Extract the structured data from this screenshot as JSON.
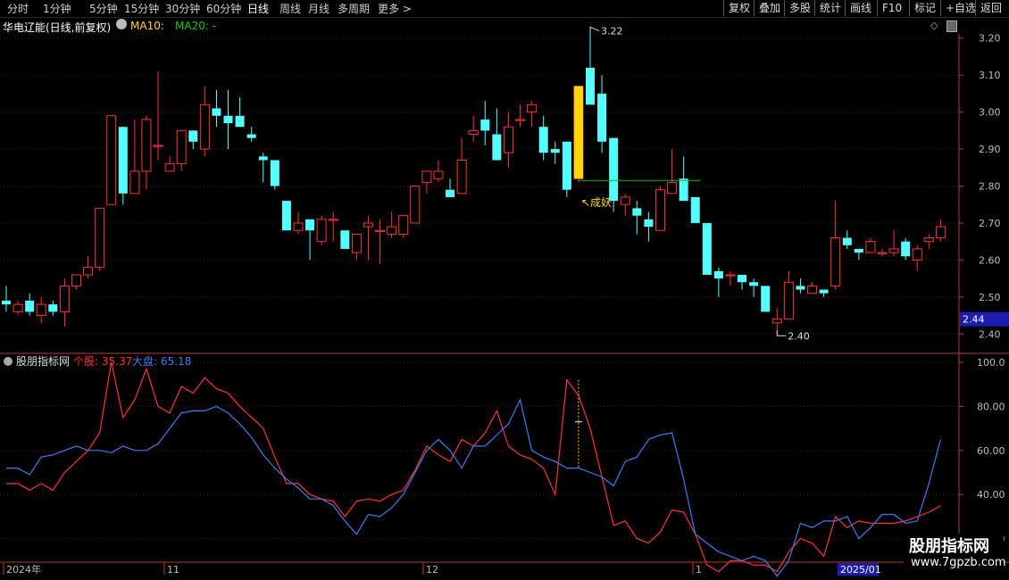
{
  "toolbar": {
    "left": [
      "分时",
      "1分钟",
      "5分钟",
      "15分钟",
      "30分钟",
      "60分钟",
      "日线",
      "周线",
      "月线",
      "多周期",
      "更多 >"
    ],
    "right": [
      "复权",
      "叠加",
      "多股",
      "统计",
      "画线",
      "F10",
      "标记",
      "+自选",
      "返回"
    ],
    "active": "日线"
  },
  "title": {
    "stock": "华电辽能(日线,前复权)",
    "ma10": "MA10: ",
    "ma20": "MA20: -"
  },
  "price_axis": {
    "labels": [
      "3.20",
      "3.10",
      "3.00",
      "2.90",
      "2.80",
      "2.70",
      "2.60",
      "2.50",
      "2.40"
    ],
    "current": "2.44"
  },
  "annotations": {
    "high": "3.22",
    "low": "2.40",
    "signal": "↖成妖"
  },
  "indicator": {
    "name": "股朋指标网",
    "s1_label": "个股: ",
    "s1_value": "35.37",
    "s2_label": "大盘: ",
    "s2_value": "65.18",
    "axis": [
      "100.0",
      "80.00",
      "60.00",
      "40.00",
      "20.00"
    ]
  },
  "date_axis": {
    "labels": [
      "2024年",
      "11",
      "12",
      "1",
      "2025/01"
    ]
  },
  "brand": {
    "line1": "股朋指标网",
    "line2": "www.7gpzb.com"
  },
  "colors": {
    "up": "#ff3232",
    "down": "#54ffff",
    "axis": "#c0392b",
    "signal": "#ffd700",
    "ma": "#00c000",
    "blue": "#3a7ef0"
  },
  "chart_data": {
    "type": "candlestick",
    "ylim": [
      2.35,
      3.25
    ],
    "candles": [
      [
        2.49,
        2.48,
        2.53,
        2.46
      ],
      [
        2.46,
        2.48,
        2.49,
        2.45
      ],
      [
        2.49,
        2.46,
        2.51,
        2.45
      ],
      [
        2.45,
        2.48,
        2.5,
        2.43
      ],
      [
        2.48,
        2.46,
        2.49,
        2.45
      ],
      [
        2.46,
        2.53,
        2.55,
        2.42
      ],
      [
        2.53,
        2.56,
        2.56,
        2.52
      ],
      [
        2.56,
        2.58,
        2.61,
        2.55
      ],
      [
        2.58,
        2.74,
        2.74,
        2.57
      ],
      [
        2.75,
        2.99,
        2.99,
        2.75
      ],
      [
        2.96,
        2.78,
        2.96,
        2.75
      ],
      [
        2.78,
        2.84,
        2.98,
        2.78
      ],
      [
        2.84,
        2.98,
        2.99,
        2.79
      ],
      [
        2.91,
        2.91,
        3.11,
        2.87
      ],
      [
        2.84,
        2.86,
        2.88,
        2.84
      ],
      [
        2.86,
        2.95,
        2.95,
        2.84
      ],
      [
        2.95,
        2.92,
        2.95,
        2.9
      ],
      [
        2.9,
        3.02,
        3.07,
        2.88
      ],
      [
        3.01,
        2.99,
        3.06,
        2.96
      ],
      [
        2.99,
        2.97,
        3.06,
        2.9
      ],
      [
        2.99,
        2.96,
        3.04,
        2.96
      ],
      [
        2.94,
        2.93,
        2.96,
        2.92
      ],
      [
        2.88,
        2.87,
        2.89,
        2.81
      ],
      [
        2.87,
        2.8,
        2.87,
        2.79
      ],
      [
        2.76,
        2.68,
        2.76,
        2.68
      ],
      [
        2.68,
        2.7,
        2.73,
        2.67
      ],
      [
        2.71,
        2.68,
        2.71,
        2.6
      ],
      [
        2.65,
        2.71,
        2.72,
        2.64
      ],
      [
        2.71,
        2.71,
        2.73,
        2.65
      ],
      [
        2.68,
        2.63,
        2.68,
        2.63
      ],
      [
        2.62,
        2.67,
        2.67,
        2.6
      ],
      [
        2.69,
        2.7,
        2.72,
        2.6
      ],
      [
        2.68,
        2.68,
        2.71,
        2.59
      ],
      [
        2.67,
        2.69,
        2.73,
        2.66
      ],
      [
        2.67,
        2.72,
        2.72,
        2.66
      ],
      [
        2.7,
        2.8,
        2.8,
        2.7
      ],
      [
        2.81,
        2.84,
        2.84,
        2.78
      ],
      [
        2.82,
        2.84,
        2.87,
        2.81
      ],
      [
        2.79,
        2.77,
        2.82,
        2.77
      ],
      [
        2.78,
        2.87,
        2.93,
        2.78
      ],
      [
        2.94,
        2.95,
        2.99,
        2.92
      ],
      [
        2.98,
        2.95,
        3.03,
        2.91
      ],
      [
        2.94,
        2.87,
        3.01,
        2.87
      ],
      [
        2.89,
        2.96,
        3.0,
        2.85
      ],
      [
        2.98,
        2.98,
        3.02,
        2.96
      ],
      [
        3.0,
        3.02,
        3.03,
        2.96
      ],
      [
        2.96,
        2.89,
        2.99,
        2.87
      ],
      [
        2.9,
        2.89,
        2.92,
        2.86
      ],
      [
        2.92,
        2.79,
        2.92,
        2.77
      ],
      [
        2.82,
        3.07,
        3.07,
        2.81
      ],
      [
        3.12,
        3.02,
        3.22,
        3.02
      ],
      [
        3.05,
        2.92,
        3.1,
        2.89
      ],
      [
        2.93,
        2.76,
        2.93,
        2.73
      ],
      [
        2.75,
        2.77,
        2.78,
        2.72
      ],
      [
        2.74,
        2.72,
        2.76,
        2.67
      ],
      [
        2.71,
        2.69,
        2.73,
        2.65
      ],
      [
        2.68,
        2.79,
        2.8,
        2.68
      ],
      [
        2.78,
        2.81,
        2.9,
        2.78
      ],
      [
        2.82,
        2.76,
        2.88,
        2.76
      ],
      [
        2.77,
        2.7,
        2.77,
        2.7
      ],
      [
        2.7,
        2.56,
        2.7,
        2.56
      ],
      [
        2.57,
        2.55,
        2.58,
        2.5
      ],
      [
        2.56,
        2.56,
        2.57,
        2.53
      ],
      [
        2.56,
        2.54,
        2.55,
        2.52
      ],
      [
        2.54,
        2.53,
        2.55,
        2.5
      ],
      [
        2.53,
        2.46,
        2.53,
        2.46
      ],
      [
        2.43,
        2.44,
        2.47,
        2.4
      ],
      [
        2.44,
        2.54,
        2.57,
        2.44
      ],
      [
        2.53,
        2.52,
        2.55,
        2.51
      ],
      [
        2.51,
        2.53,
        2.54,
        2.51
      ],
      [
        2.52,
        2.51,
        2.52,
        2.5
      ],
      [
        2.53,
        2.66,
        2.76,
        2.52
      ],
      [
        2.66,
        2.64,
        2.68,
        2.63
      ],
      [
        2.63,
        2.62,
        2.63,
        2.6
      ],
      [
        2.62,
        2.65,
        2.66,
        2.62
      ],
      [
        2.62,
        2.62,
        2.63,
        2.61
      ],
      [
        2.62,
        2.63,
        2.68,
        2.61
      ],
      [
        2.65,
        2.61,
        2.66,
        2.6
      ],
      [
        2.6,
        2.63,
        2.64,
        2.57
      ],
      [
        2.65,
        2.66,
        2.67,
        2.63
      ],
      [
        2.66,
        2.69,
        2.71,
        2.65
      ]
    ],
    "indicator_series": [
      {
        "name": "个股",
        "color": "#ff3232",
        "values": [
          45,
          45,
          42,
          45,
          42,
          50,
          55,
          60,
          68,
          100,
          75,
          83,
          97,
          80,
          77,
          89,
          86,
          93,
          88,
          86,
          80,
          75,
          70,
          57,
          45,
          45,
          40,
          38,
          37,
          30,
          37,
          38,
          37,
          40,
          42,
          51,
          62,
          58,
          55,
          65,
          62,
          68,
          78,
          62,
          58,
          56,
          52,
          40,
          92,
          85,
          70,
          48,
          26,
          28,
          20,
          18,
          23,
          33,
          32,
          22,
          8,
          5,
          10,
          10,
          8,
          8,
          5,
          14,
          20,
          18,
          12,
          30,
          25,
          28,
          27,
          27,
          27,
          28,
          30,
          32,
          35
        ],
        "tick_values": [
          0,
          9,
          12,
          15,
          18,
          21,
          24,
          27,
          30,
          33,
          36,
          39,
          42,
          45,
          48,
          51,
          54,
          57,
          60,
          63,
          66,
          69,
          72,
          75,
          78,
          81
        ]
      },
      {
        "name": "大盘",
        "color": "#3a7ef0",
        "values": [
          52,
          52,
          49,
          57,
          58,
          60,
          62,
          60,
          60,
          59,
          62,
          60,
          60,
          63,
          70,
          77,
          78,
          78,
          80,
          77,
          72,
          66,
          58,
          52,
          47,
          43,
          38,
          38,
          35,
          28,
          22,
          31,
          30,
          34,
          40,
          50,
          60,
          65,
          60,
          52,
          62,
          62,
          67,
          72,
          83,
          60,
          57,
          55,
          52,
          52,
          50,
          48,
          44,
          55,
          57,
          65,
          67,
          68,
          47,
          22,
          18,
          14,
          12,
          10,
          12,
          10,
          3,
          10,
          27,
          25,
          28,
          28,
          30,
          20,
          25,
          31,
          31,
          27,
          28,
          45,
          65
        ]
      }
    ],
    "x_labels": [
      "2024年",
      "11",
      "12",
      "1",
      "2025/01"
    ]
  }
}
